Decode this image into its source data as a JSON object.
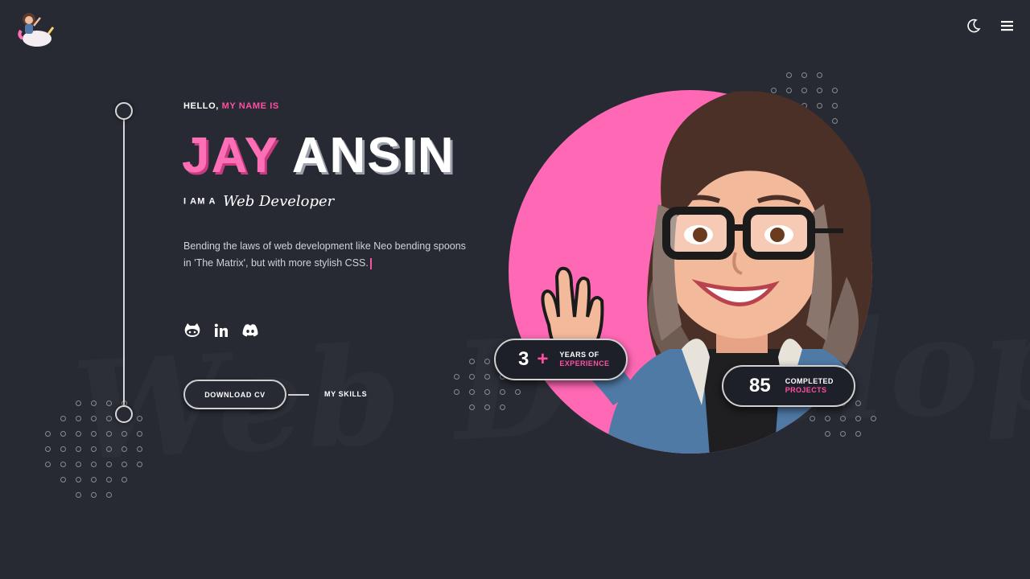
{
  "hero": {
    "greeting_prefix": "HELLO,",
    "greeting_suffix": "MY NAME IS",
    "first_name": "JAY",
    "last_name": "ANSIN",
    "role_prefix": "I AM A",
    "role_title": "Web Developer",
    "bio": "Bending the laws of web development like Neo bending spoons in 'The Matrix', but with more stylish CSS.",
    "watermark": "Web Developer"
  },
  "actions": {
    "download_cv": "DOWNLOAD CV",
    "my_skills": "MY SKILLS"
  },
  "stats": {
    "experience": {
      "value": "3",
      "plus": "+",
      "line1": "YEARS OF",
      "line2": "EXPERIENCE"
    },
    "projects": {
      "value": "85",
      "line1": "COMPLETED",
      "line2": "PROJECTS"
    }
  },
  "socials": [
    "github-icon",
    "linkedin-icon",
    "discord-icon"
  ],
  "header": {
    "icons": [
      "moon-icon",
      "menu-icon"
    ]
  },
  "colors": {
    "background": "#272a33",
    "accent": "#ff4fa3",
    "circle": "#ff68b5",
    "badge_bg": "#1e2029"
  }
}
